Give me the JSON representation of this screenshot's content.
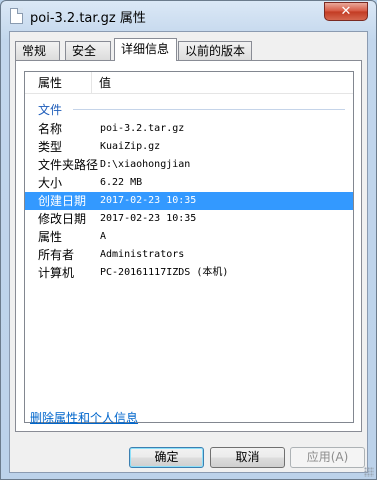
{
  "window": {
    "title": "poi-3.2.tar.gz 属性",
    "close_glyph": "✕"
  },
  "tabs": [
    {
      "label": "常规"
    },
    {
      "label": "安全"
    },
    {
      "label": "详细信息",
      "active": true
    },
    {
      "label": "以前的版本"
    }
  ],
  "details": {
    "columns": {
      "property": "属性",
      "value": "值"
    },
    "group": "文件",
    "rows": [
      {
        "label": "名称",
        "value": "poi-3.2.tar.gz"
      },
      {
        "label": "类型",
        "value": "KuaiZip.gz"
      },
      {
        "label": "文件夹路径",
        "value": "D:\\xiaohongjian"
      },
      {
        "label": "大小",
        "value": "6.22 MB"
      },
      {
        "label": "创建日期",
        "value": "2017-02-23 10:35",
        "selected": true
      },
      {
        "label": "修改日期",
        "value": "2017-02-23 10:35"
      },
      {
        "label": "属性",
        "value": "A"
      },
      {
        "label": "所有者",
        "value": "Administrators"
      },
      {
        "label": "计算机",
        "value": "PC-20161117IZDS (本机)"
      }
    ]
  },
  "remove_link": "删除属性和个人信息",
  "buttons": {
    "ok": "确定",
    "cancel": "取消",
    "apply": "应用(A)"
  },
  "colors": {
    "selection": "#3399ff",
    "link": "#0066cc",
    "group_header": "#1e5dba"
  }
}
